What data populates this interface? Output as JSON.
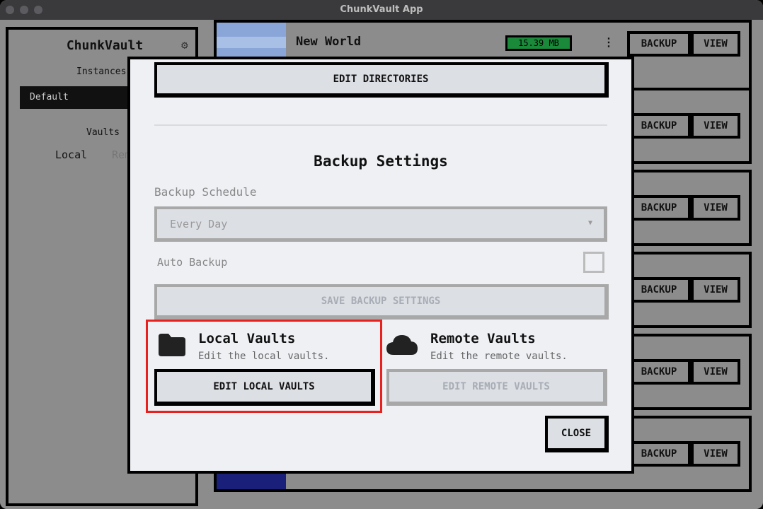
{
  "window": {
    "title": "ChunkVault App"
  },
  "sidebar": {
    "title": "ChunkVault",
    "instances_label": "Instances",
    "selected_instance": "Default",
    "vaults_label": "Vaults",
    "tabs": [
      "Local",
      "Remote"
    ]
  },
  "worlds": [
    {
      "name": "New World",
      "size": "15.39 MB",
      "backup_label": "BACKUP",
      "view_label": "VIEW"
    },
    {
      "backup_label": "BACKUP",
      "view_label": "VIEW"
    },
    {
      "backup_label": "BACKUP",
      "view_label": "VIEW"
    },
    {
      "backup_label": "BACKUP",
      "view_label": "VIEW"
    },
    {
      "backup_label": "BACKUP",
      "view_label": "VIEW"
    },
    {
      "backup_label": "BACKUP",
      "view_label": "VIEW"
    }
  ],
  "dialog": {
    "edit_directories_label": "EDIT DIRECTORIES",
    "heading": "Backup Settings",
    "schedule_label": "Backup Schedule",
    "schedule_value": "Every Day",
    "auto_backup_label": "Auto Backup",
    "auto_backup_checked": false,
    "save_label": "SAVE BACKUP SETTINGS",
    "local": {
      "title": "Local Vaults",
      "subtitle": "Edit the local vaults.",
      "button": "EDIT LOCAL VAULTS"
    },
    "remote": {
      "title": "Remote Vaults",
      "subtitle": "Edit the remote vaults.",
      "button": "EDIT REMOTE VAULTS"
    },
    "close_label": "CLOSE"
  },
  "colors": {
    "highlight": "#e8201e",
    "badge": "#1a8a3a"
  },
  "icons": {
    "settings": "gear-icon",
    "local": "folder-icon",
    "remote": "cloud-icon",
    "menu": "kebab-menu-icon",
    "select": "chevron-down-icon"
  }
}
